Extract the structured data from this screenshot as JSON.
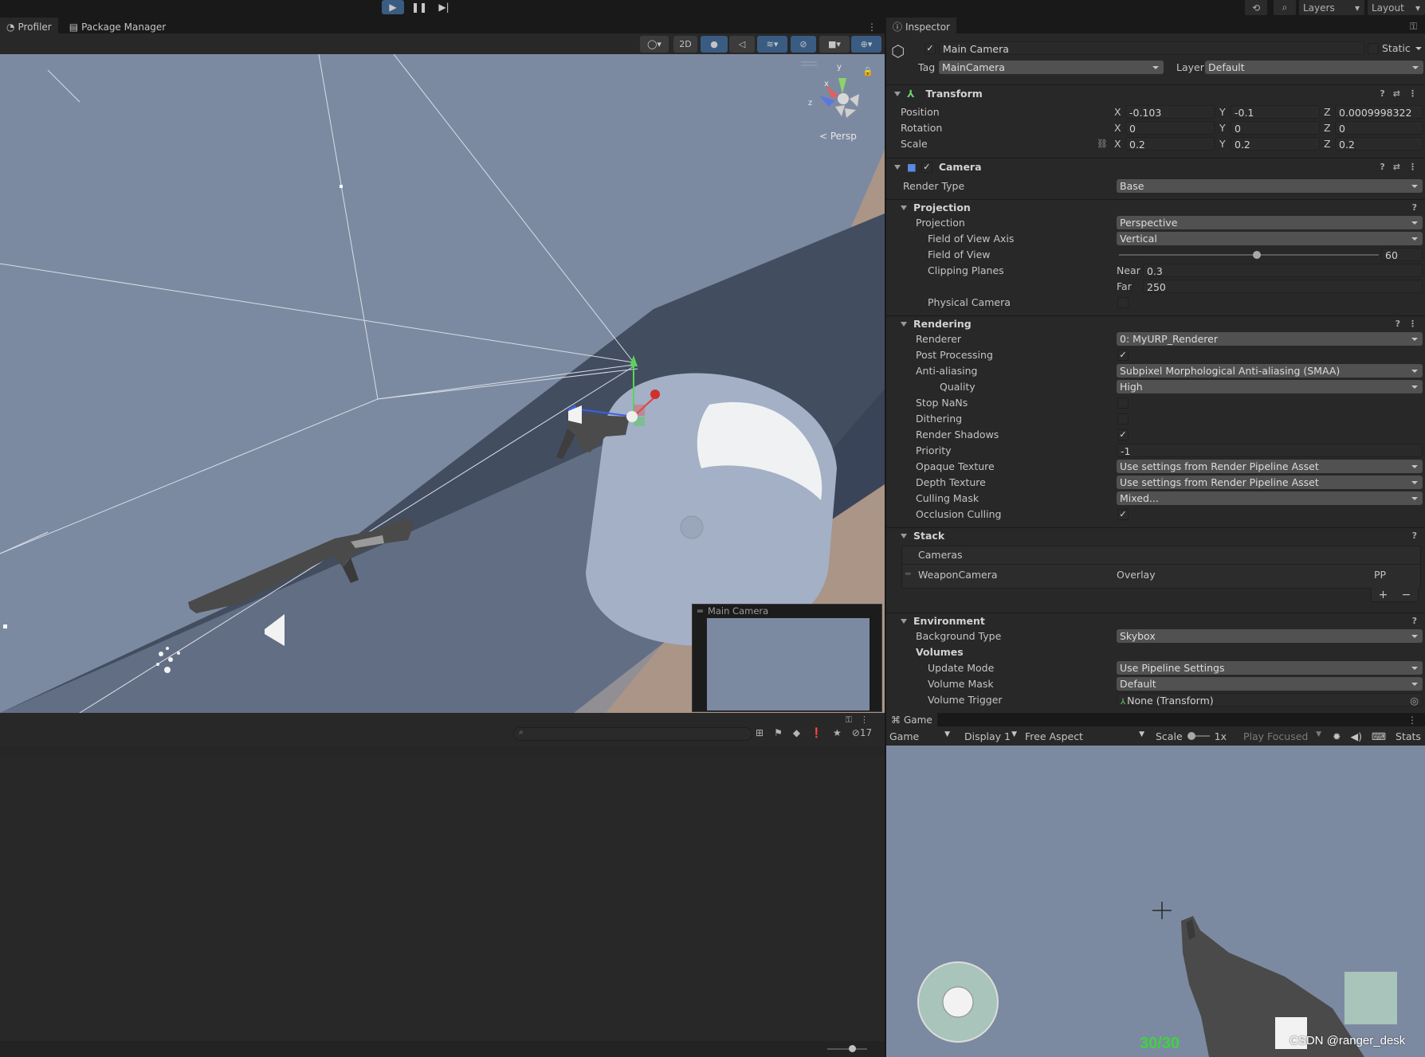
{
  "toolbar": {
    "layers_label": "Layers",
    "layout_label": "Layout"
  },
  "tabs": {
    "profiler": "Profiler",
    "package_manager": "Package Manager",
    "inspector": "Inspector",
    "game": "Game"
  },
  "scene": {
    "persp_label": "< Persp",
    "mode_2d": "2D",
    "preview_title": "Main Camera",
    "hidden_count": "17"
  },
  "inspector": {
    "object_name": "Main Camera",
    "static_label": "Static",
    "tag_label": "Tag",
    "tag_value": "MainCamera",
    "layer_label": "Layer",
    "layer_value": "Default",
    "transform": {
      "title": "Transform",
      "position_label": "Position",
      "rotation_label": "Rotation",
      "scale_label": "Scale",
      "x": "X",
      "y": "Y",
      "z": "Z",
      "position": [
        "-0.103",
        "-0.1",
        "0.0009998322"
      ],
      "rotation": [
        "0",
        "0",
        "0"
      ],
      "scale": [
        "0.2",
        "0.2",
        "0.2"
      ]
    },
    "camera": {
      "title": "Camera",
      "render_type_label": "Render Type",
      "render_type": "Base",
      "projection_section": "Projection",
      "projection_label": "Projection",
      "projection": "Perspective",
      "fov_axis_label": "Field of View Axis",
      "fov_axis": "Vertical",
      "fov_label": "Field of View",
      "fov": "60",
      "fov_slider_fraction": 0.53,
      "clipping_label": "Clipping Planes",
      "near_label": "Near",
      "near": "0.3",
      "far_label": "Far",
      "far": "250",
      "physical_label": "Physical Camera",
      "rendering_section": "Rendering",
      "renderer_label": "Renderer",
      "renderer": "0: MyURP_Renderer",
      "post_label": "Post Processing",
      "aa_label": "Anti-aliasing",
      "aa": "Subpixel Morphological Anti-aliasing (SMAA)",
      "quality_label": "Quality",
      "quality": "High",
      "stopnans_label": "Stop NaNs",
      "dithering_label": "Dithering",
      "shadows_label": "Render Shadows",
      "priority_label": "Priority",
      "priority": "-1",
      "opaque_label": "Opaque Texture",
      "opaque": "Use settings from Render Pipeline Asset",
      "depth_label": "Depth Texture",
      "depth": "Use settings from Render Pipeline Asset",
      "culling_label": "Culling Mask",
      "culling": "Mixed...",
      "occlusion_label": "Occlusion Culling",
      "stack_section": "Stack",
      "cameras_label": "Cameras",
      "stack_camera": "WeaponCamera",
      "stack_type": "Overlay",
      "stack_pp": "PP",
      "add": "+",
      "remove": "−",
      "environment_section": "Environment",
      "bg_label": "Background Type",
      "bg": "Skybox",
      "volumes_label": "Volumes",
      "update_label": "Update Mode",
      "update": "Use Pipeline Settings",
      "mask_label": "Volume Mask",
      "mask": "Default",
      "trigger_label": "Volume Trigger",
      "trigger": "None (Transform)"
    }
  },
  "game_view": {
    "display_mode": "Game",
    "display": "Display 1",
    "aspect": "Free Aspect",
    "scale_label": "Scale",
    "scale_value": "1x",
    "play_focused": "Play Focused",
    "stats": "Stats",
    "ammo": "30/30",
    "watermark": "CSDN @ranger_desk"
  },
  "colors": {
    "accent": "#3a5c82",
    "sky": "#7c8aa1",
    "ammo": "#3fd43f",
    "panel": "#282828"
  }
}
